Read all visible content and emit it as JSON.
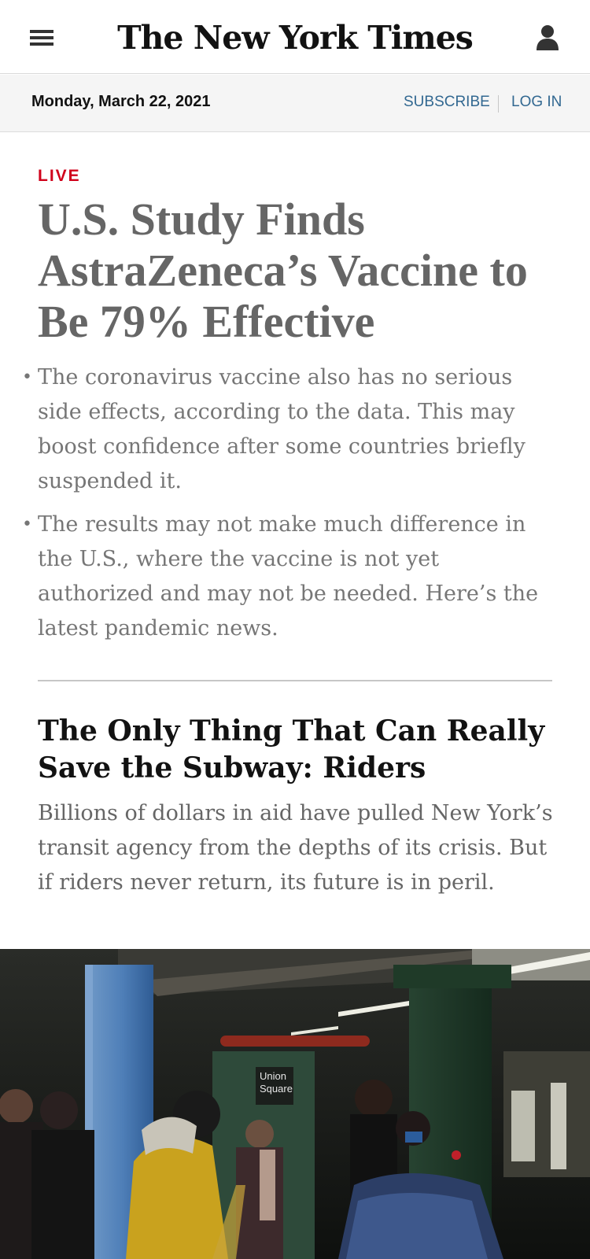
{
  "header": {
    "logo": "The New York Times",
    "menu_icon": "hamburger-menu-icon",
    "account_icon": "user-account-icon"
  },
  "datebar": {
    "date": "Monday, March 22, 2021",
    "subscribe": "SUBSCRIBE",
    "login": "LOG IN"
  },
  "lead_story": {
    "label": "LIVE",
    "headline": "U.S. Study Finds AstraZeneca’s Vaccine to Be 79% Effective",
    "summary": [
      "The coronavirus vaccine also has no serious side effects, according to the data. This may boost confidence after some countries briefly suspended it.",
      "The results may not make much difference in the U.S., where the vaccine is not yet authorized and may not be needed. Here’s the latest pandemic news."
    ]
  },
  "second_story": {
    "headline": "The Only Thing That Can Really Save the Subway: Riders",
    "summary": "Billions of dollars in aid have pulled New York’s transit agency from the depths of its crisis. But if riders never return, its future is in peril.",
    "photo": {
      "station_sign": [
        "Union",
        "Square"
      ]
    }
  },
  "colors": {
    "live_red": "#d0021b",
    "link_blue": "#326891",
    "headline_gray": "#666666",
    "text_gray": "#767676",
    "datebar_bg": "#f5f5f5"
  }
}
